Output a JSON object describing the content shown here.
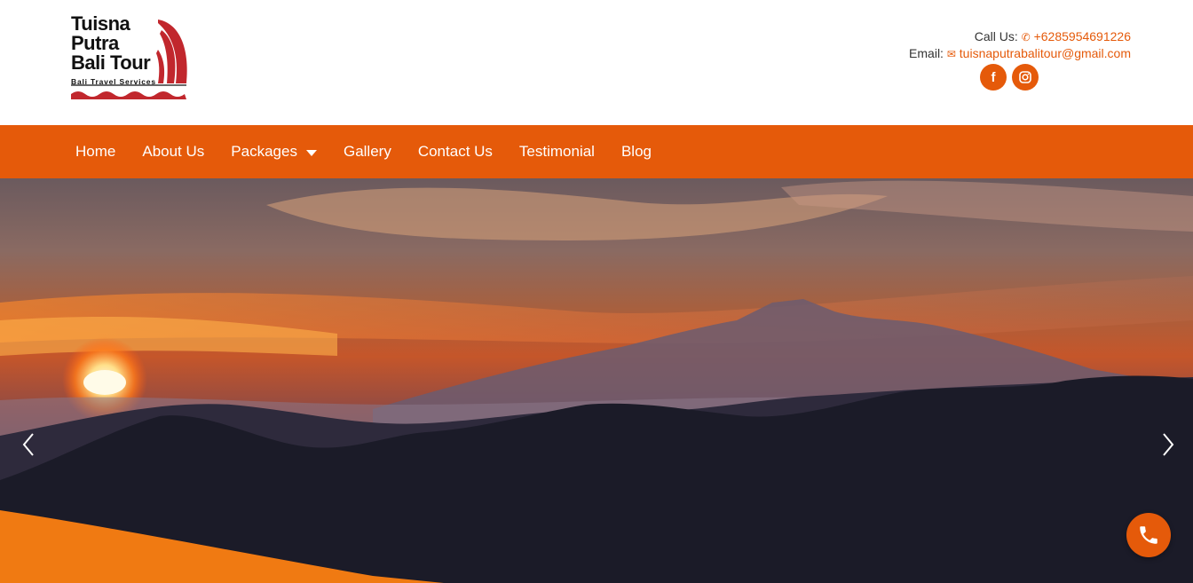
{
  "brand": {
    "line1": "Tuisna",
    "line2": "Putra",
    "line3": "Bali Tour",
    "tagline": "Bali Travel Services"
  },
  "contact": {
    "call_label": "Call Us:",
    "phone": "+6285954691226",
    "email_label": "Email:",
    "email": "tuisnaputrabalitour@gmail.com"
  },
  "socials": {
    "facebook_glyph": "f",
    "instagram_glyph": "◎"
  },
  "nav": {
    "items": [
      {
        "label": "Home"
      },
      {
        "label": "About Us"
      },
      {
        "label": "Packages"
      },
      {
        "label": "Gallery"
      },
      {
        "label": "Contact Us"
      },
      {
        "label": "Testimonial"
      },
      {
        "label": "Blog"
      }
    ]
  },
  "colors": {
    "accent": "#e55a0a",
    "logo_red": "#c1272d"
  },
  "icons": {
    "phone": "phone-icon",
    "email": "envelope-icon",
    "facebook": "facebook-icon",
    "instagram": "instagram-icon",
    "prev": "chevron-left-icon",
    "next": "chevron-right-icon",
    "call": "phone-call-icon"
  }
}
